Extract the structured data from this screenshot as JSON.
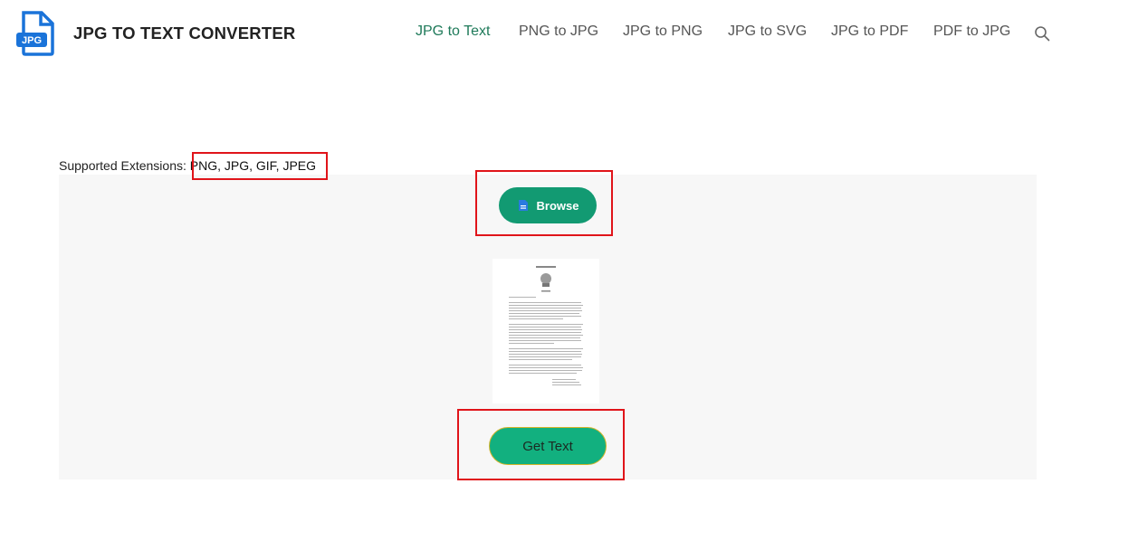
{
  "header": {
    "brand": "JPG TO TEXT CONVERTER",
    "logo_text": "JPG",
    "nav": [
      {
        "label": "JPG to Text",
        "active": true
      },
      {
        "label": "PNG to JPG",
        "active": false
      },
      {
        "label": "JPG to PNG",
        "active": false
      },
      {
        "label": "JPG to SVG",
        "active": false
      },
      {
        "label": "JPG to PDF",
        "active": false
      },
      {
        "label": "PDF to JPG",
        "active": false
      }
    ],
    "search_icon": "search-icon"
  },
  "main": {
    "supported_label": "Supported Extensions:",
    "supported_values": "PNG, JPG, GIF, JPEG",
    "browse_label": "Browse",
    "browse_icon": "file-icon",
    "get_text_label": "Get Text"
  },
  "colors": {
    "accent": "#129a72",
    "nav_active": "#1f7a5a",
    "highlight": "#e0141a",
    "logo_blue": "#1a73d9"
  }
}
